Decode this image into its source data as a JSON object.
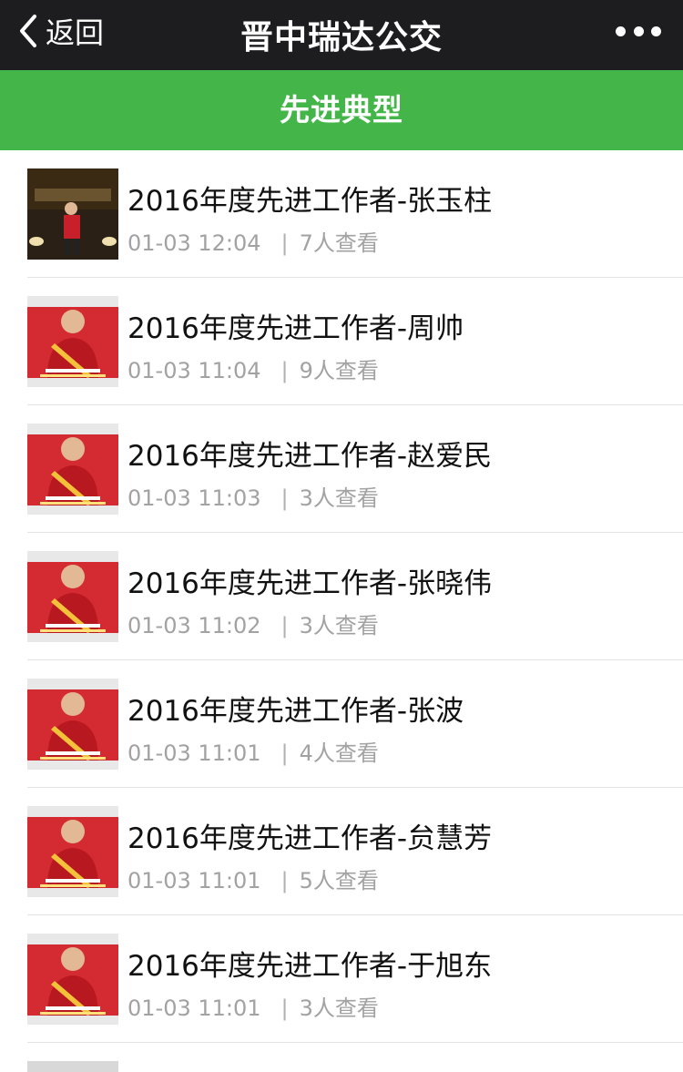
{
  "navbar": {
    "back_label": "返回",
    "title": "晋中瑞达公交",
    "more_icon": "more-dots-icon"
  },
  "banner": {
    "title": "先进典型"
  },
  "articles": [
    {
      "title": "2016年度先进工作者-张玉柱",
      "date": "01-03 12:04",
      "views": "7人查看",
      "thumb_variant": "stage"
    },
    {
      "title": "2016年度先进工作者-周帅",
      "date": "01-03 11:04",
      "views": "9人查看",
      "thumb_variant": "red"
    },
    {
      "title": "2016年度先进工作者-赵爱民",
      "date": "01-03 11:03",
      "views": "3人查看",
      "thumb_variant": "red"
    },
    {
      "title": "2016年度先进工作者-张晓伟",
      "date": "01-03 11:02",
      "views": "3人查看",
      "thumb_variant": "red"
    },
    {
      "title": "2016年度先进工作者-张波",
      "date": "01-03 11:01",
      "views": "4人查看",
      "thumb_variant": "red"
    },
    {
      "title": "2016年度先进工作者-贠慧芳",
      "date": "01-03 11:01",
      "views": "5人查看",
      "thumb_variant": "red"
    },
    {
      "title": "2016年度先进工作者-于旭东",
      "date": "01-03 11:01",
      "views": "3人查看",
      "thumb_variant": "red"
    }
  ],
  "colors": {
    "navbar_bg": "#1d1d1f",
    "banner_bg": "#44b549",
    "meta_text": "#a2a2a2",
    "thumb_red": "#c8202a"
  }
}
